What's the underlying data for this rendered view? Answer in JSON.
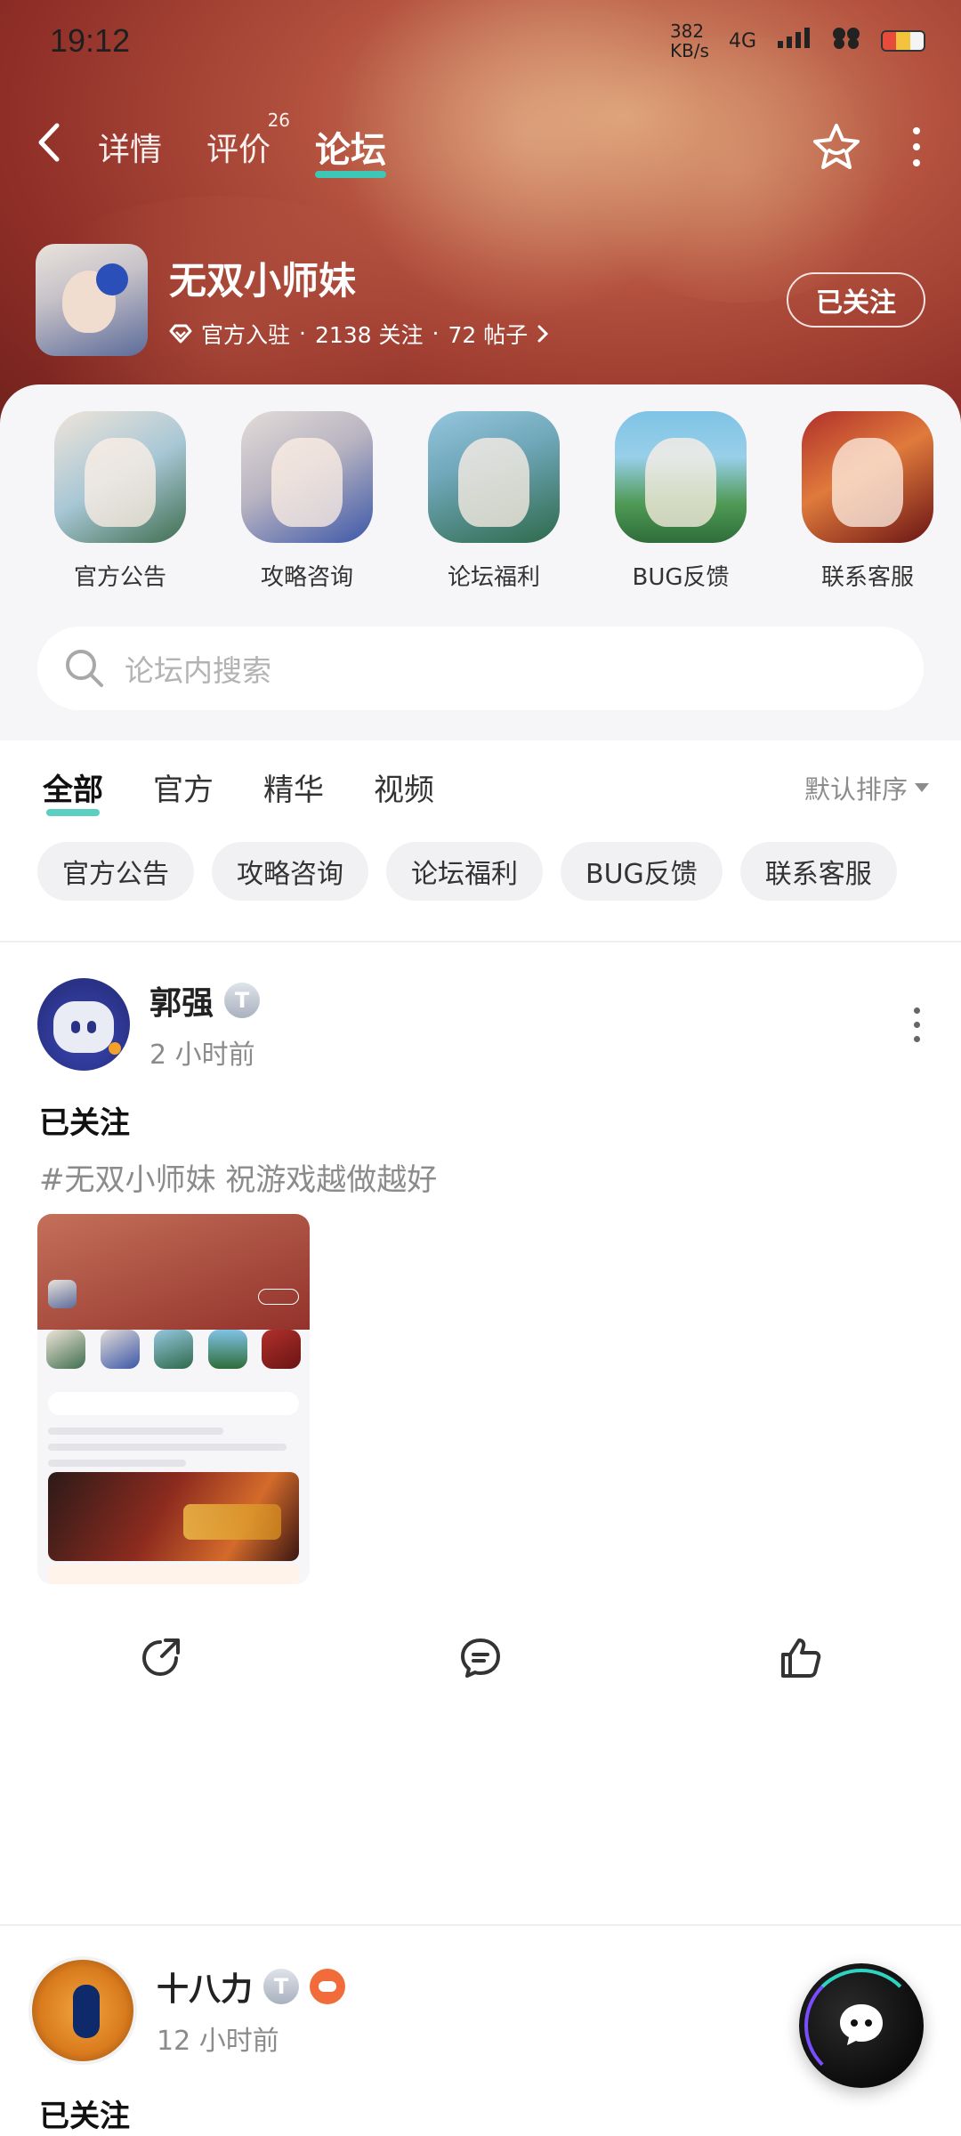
{
  "status": {
    "time": "19:12",
    "net_speed_value": "382",
    "net_speed_unit": "KB/s",
    "network": "4G"
  },
  "nav": {
    "tabs": [
      {
        "label": "详情"
      },
      {
        "label": "评价",
        "badge": "26"
      },
      {
        "label": "论坛"
      }
    ]
  },
  "forum": {
    "name": "无双小师妹",
    "official": "官方入驻",
    "followers": "2138 关注",
    "posts": "72 帖子",
    "follow_label": "已关注"
  },
  "boards": [
    {
      "label": "官方公告",
      "icon": "official-notice-thumb"
    },
    {
      "label": "攻略咨询",
      "icon": "guide-thumb"
    },
    {
      "label": "论坛福利",
      "icon": "welfare-thumb"
    },
    {
      "label": "BUG反馈",
      "icon": "bug-feedback-thumb"
    },
    {
      "label": "联系客服",
      "icon": "customer-service-thumb"
    }
  ],
  "search": {
    "placeholder": "论坛内搜索"
  },
  "category_tabs": [
    {
      "label": "全部"
    },
    {
      "label": "官方"
    },
    {
      "label": "精华"
    },
    {
      "label": "视频"
    }
  ],
  "sort_label": "默认排序",
  "chips": [
    {
      "label": "官方公告"
    },
    {
      "label": "攻略咨询"
    },
    {
      "label": "论坛福利"
    },
    {
      "label": "BUG反馈"
    },
    {
      "label": "联系客服"
    }
  ],
  "posts": [
    {
      "author": "郭强",
      "level": "T",
      "time": "2 小时前",
      "title": "已关注",
      "text": "#无双小师妹 祝游戏越做越好"
    },
    {
      "author": "十八力",
      "level": "T",
      "time": "12 小时前",
      "title": "已关注"
    }
  ],
  "colors": {
    "accent": "#3ec7b6",
    "header_red": "#9a3429",
    "muted_text": "#8b8b8b"
  }
}
